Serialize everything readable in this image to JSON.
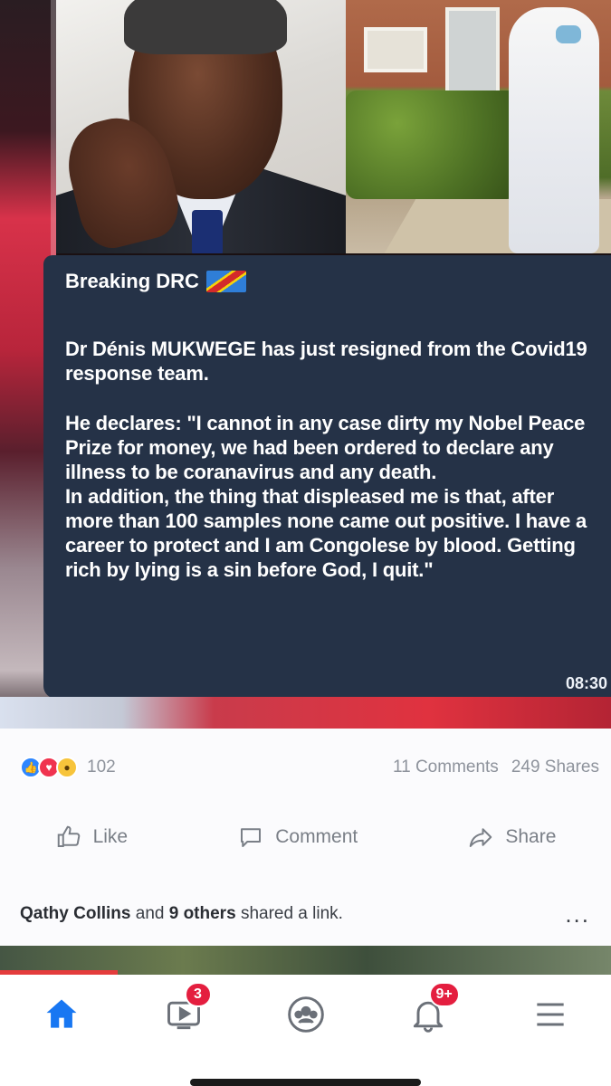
{
  "post_media": {
    "headline": "Breaking DRC",
    "paragraph_1": "Dr Dénis MUKWEGE has just resigned from the Covid19 response team.",
    "paragraph_2": "He declares: \"I cannot in any case dirty my Nobel Peace Prize for money, we had been ordered to declare any illness to be coranavirus and any death.",
    "paragraph_3": "In addition, the thing that displeased me is that, after more than 100 samples none came out positive. I have a career to protect and I am Congolese by blood. Getting rich by lying is a sin before God, I quit.\"",
    "timestamp": "08:30"
  },
  "reactions": {
    "icons": [
      "like-icon",
      "love-icon",
      "wow-icon"
    ],
    "count": "102",
    "comments": "11 Comments",
    "shares": "249 Shares"
  },
  "actions": {
    "like_label": "Like",
    "comment_label": "Comment",
    "share_label": "Share"
  },
  "share_note": {
    "name": "Qathy Collins",
    "connector": "and",
    "others": "9 others",
    "suffix": "shared a link.",
    "more": "..."
  },
  "bottom_nav": {
    "home_active_color": "#1877f2",
    "watch_badge": "3",
    "notifications_badge": "9+"
  }
}
